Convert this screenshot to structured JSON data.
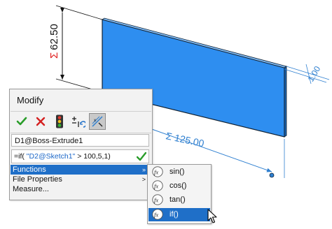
{
  "viewport": {
    "dim_vertical": {
      "sigma": "Σ",
      "value": "62.50"
    },
    "dim_horizontal": {
      "sigma": "Σ",
      "value": "125.00"
    },
    "dim_thickness": {
      "value": "1.00"
    },
    "colors": {
      "part": "#2e8ef0",
      "dim_blue": "#2e7fd0",
      "sigma_red": "#e02020"
    }
  },
  "modify": {
    "title": "Modify",
    "toolbar": {
      "ok_icon": "check-icon",
      "cancel_icon": "x-icon",
      "rebuild_icon": "traffic-light-icon",
      "spin_icon": "spin-increment-icon",
      "mark_icon": "mark-dimension-icon"
    },
    "dimension_name": "D1@Boss-Extrude1",
    "expression": {
      "prefix": "=if( ",
      "ref": "\"D2@Sketch1\"",
      "suffix": " > 100,5,1)"
    },
    "menu": [
      {
        "label": "Functions",
        "arrow": "»",
        "active": true
      },
      {
        "label": "File Properties",
        "arrow": ">",
        "active": false
      },
      {
        "label": "Measure...",
        "arrow": "",
        "active": false
      }
    ]
  },
  "submenu": {
    "items": [
      {
        "label": "sin()",
        "icon": "fx-icon",
        "active": false
      },
      {
        "label": "cos()",
        "icon": "fx-icon",
        "active": false
      },
      {
        "label": "tan()",
        "icon": "fx-icon",
        "active": false
      },
      {
        "label": "if()",
        "icon": "fx-icon",
        "active": true
      }
    ]
  }
}
